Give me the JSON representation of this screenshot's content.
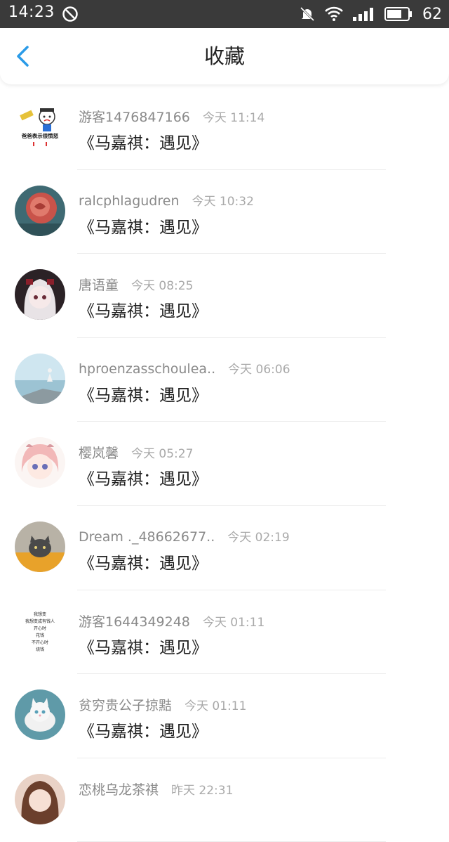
{
  "status_bar": {
    "time": "14:23",
    "battery": "62",
    "icons": [
      "dnd-icon",
      "mute-icon",
      "wifi-icon",
      "signal-icon",
      "battery-icon"
    ]
  },
  "header": {
    "title": "收藏",
    "back_icon": "chevron-left-icon",
    "accent_color": "#2a9be8"
  },
  "items": [
    {
      "user": "游客1476847166",
      "time": "今天 11:14",
      "title": "《马嘉祺：遇见》"
    },
    {
      "user": "ralcphlagudren",
      "time": "今天 10:32",
      "title": "《马嘉祺：遇见》"
    },
    {
      "user": "唐语童",
      "time": "今天 08:25",
      "title": "《马嘉祺：遇见》"
    },
    {
      "user": "hproenzasschoulea..",
      "time": "今天 06:06",
      "title": "《马嘉祺：遇见》"
    },
    {
      "user": "樱岚馨",
      "time": "今天 05:27",
      "title": "《马嘉祺：遇见》"
    },
    {
      "user": "Dream ._48662677..",
      "time": "今天 02:19",
      "title": "《马嘉祺：遇见》"
    },
    {
      "user": "游客1644349248",
      "time": "今天 01:11",
      "title": "《马嘉祺：遇见》"
    },
    {
      "user": "贫穷贵公子掠黠",
      "time": "今天 01:11",
      "title": "《马嘉祺：遇见》"
    },
    {
      "user": "恋桃乌龙茶祺",
      "time": "昨天 22:31",
      "title": ""
    }
  ],
  "avatar_texts": {
    "a0": "爸爸表示很愤怒",
    "a6": [
      "我想变",
      "我想变成有钱人",
      "开心时",
      "花钱",
      "不开心时",
      "烧钱"
    ]
  }
}
